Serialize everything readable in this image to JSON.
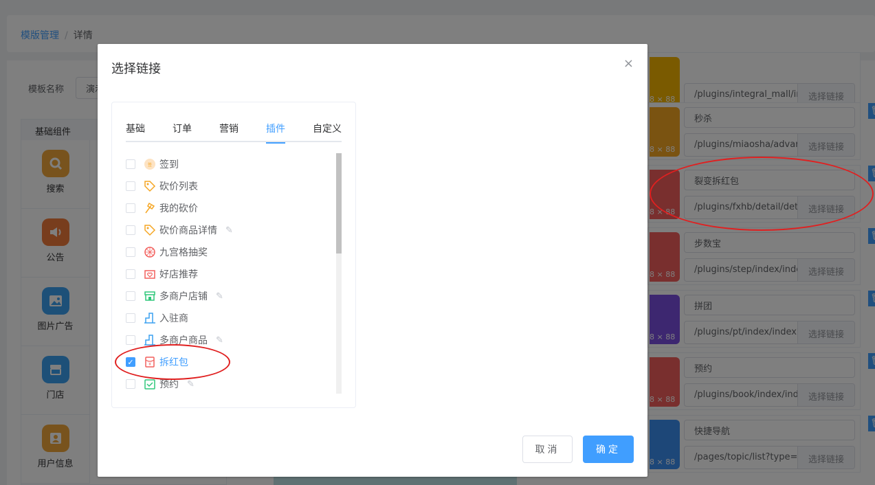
{
  "breadcrumb": {
    "root": "模版管理",
    "separator": "/",
    "current": "详情"
  },
  "template": {
    "label": "模板名称",
    "value": "演示"
  },
  "components": {
    "header": "基础组件",
    "items": [
      {
        "label": "搜索",
        "icon": "search-icon",
        "color": "#f0a63a"
      },
      {
        "label": "公告",
        "icon": "speaker-icon",
        "color": "#f07a3a"
      },
      {
        "label": "图片广告",
        "icon": "image-icon",
        "color": "#3aa0f0"
      },
      {
        "label": "门店",
        "icon": "store-icon",
        "color": "#3aa0f0"
      },
      {
        "label": "用户信息",
        "icon": "user-card-icon",
        "color": "#f0a63a"
      }
    ]
  },
  "link_rows": [
    {
      "name": "",
      "url": "/plugins/integral_mall/ir",
      "button": "选择链接",
      "size": "8 × 88",
      "color": "#f5b400"
    },
    {
      "name": "秒杀",
      "url": "/plugins/miaosha/advar",
      "button": "选择链接",
      "size": "8 × 88",
      "color": "#f5a623"
    },
    {
      "name": "裂变拆红包",
      "url": "/plugins/fxhb/detail/deta",
      "button": "选择链接",
      "size": "8 × 88",
      "color": "#f25f5c"
    },
    {
      "name": "步数宝",
      "url": "/plugins/step/index/inde",
      "button": "选择链接",
      "size": "8 × 88",
      "color": "#f25f5c"
    },
    {
      "name": "拼团",
      "url": "/plugins/pt/index/index?",
      "button": "选择链接",
      "size": "8 × 88",
      "color": "#7b4fe0"
    },
    {
      "name": "预约",
      "url": "/plugins/book/index/ind",
      "button": "选择链接",
      "size": "8 × 88",
      "color": "#f25f5c"
    },
    {
      "name": "快捷导航",
      "url": "/pages/topic/list?type=",
      "button": "选择链接",
      "size": "8 × 88",
      "color": "#3a8ef0"
    }
  ],
  "dialog": {
    "title": "选择链接",
    "close_glyph": "×",
    "tabs": [
      {
        "label": "基础",
        "active": false
      },
      {
        "label": "订单",
        "active": false
      },
      {
        "label": "营销",
        "active": false
      },
      {
        "label": "插件",
        "active": true
      },
      {
        "label": "自定义",
        "active": false
      }
    ],
    "items": [
      {
        "label": "签到",
        "icon": "sign-in-icon",
        "color": "#f5a623",
        "checked": false,
        "editable": false
      },
      {
        "label": "砍价列表",
        "icon": "tag-icon",
        "color": "#f5a623",
        "checked": false,
        "editable": false
      },
      {
        "label": "我的砍价",
        "icon": "axe-icon",
        "color": "#f5a623",
        "checked": false,
        "editable": false
      },
      {
        "label": "砍价商品详情",
        "icon": "tag-icon",
        "color": "#f5a623",
        "checked": false,
        "editable": true
      },
      {
        "label": "九宫格抽奖",
        "icon": "lottery-icon",
        "color": "#f25f5c",
        "checked": false,
        "editable": false
      },
      {
        "label": "好店推荐",
        "icon": "shop-heart-icon",
        "color": "#f25f5c",
        "checked": false,
        "editable": false
      },
      {
        "label": "多商户店铺",
        "icon": "storefront-icon",
        "color": "#2ec77a",
        "checked": false,
        "editable": true
      },
      {
        "label": "入驻商",
        "icon": "building-icon",
        "color": "#3aa0f0",
        "checked": false,
        "editable": false
      },
      {
        "label": "多商户商品",
        "icon": "building-icon",
        "color": "#3aa0f0",
        "checked": false,
        "editable": true
      },
      {
        "label": "拆红包",
        "icon": "red-envelope-icon",
        "color": "#f25f5c",
        "checked": true,
        "editable": false
      },
      {
        "label": "预约",
        "icon": "calendar-check-icon",
        "color": "#2ec77a",
        "checked": false,
        "editable": true
      }
    ],
    "cancel_label": "取消",
    "ok_label": "确定"
  },
  "colors": {
    "primary": "#409eff",
    "annotation": "#e02020"
  }
}
